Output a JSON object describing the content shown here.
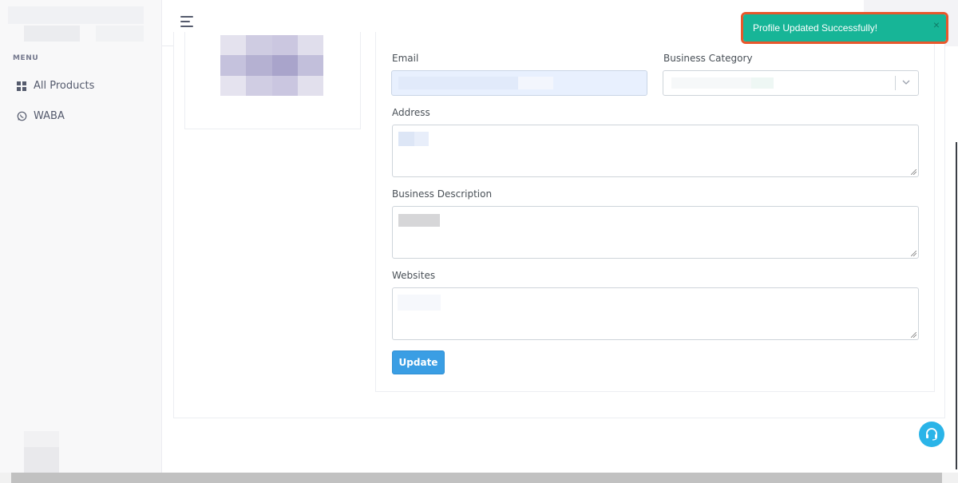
{
  "sidebar": {
    "menu_title": "MENU",
    "items": [
      {
        "label": "All Products",
        "icon": "grid-icon"
      },
      {
        "label": "WABA",
        "icon": "whatsapp-icon"
      }
    ]
  },
  "form": {
    "email_label": "Email",
    "category_label": "Business Category",
    "address_label": "Address",
    "description_label": "Business Description",
    "websites_label": "Websites",
    "update_label": "Update"
  },
  "toast": {
    "message": "Profile Updated Successfully!",
    "close": "×",
    "color": "#17b597"
  },
  "colors": {
    "accent": "#3a9ee4",
    "help": "#2ab4e8",
    "highlight": "#e8572b"
  }
}
